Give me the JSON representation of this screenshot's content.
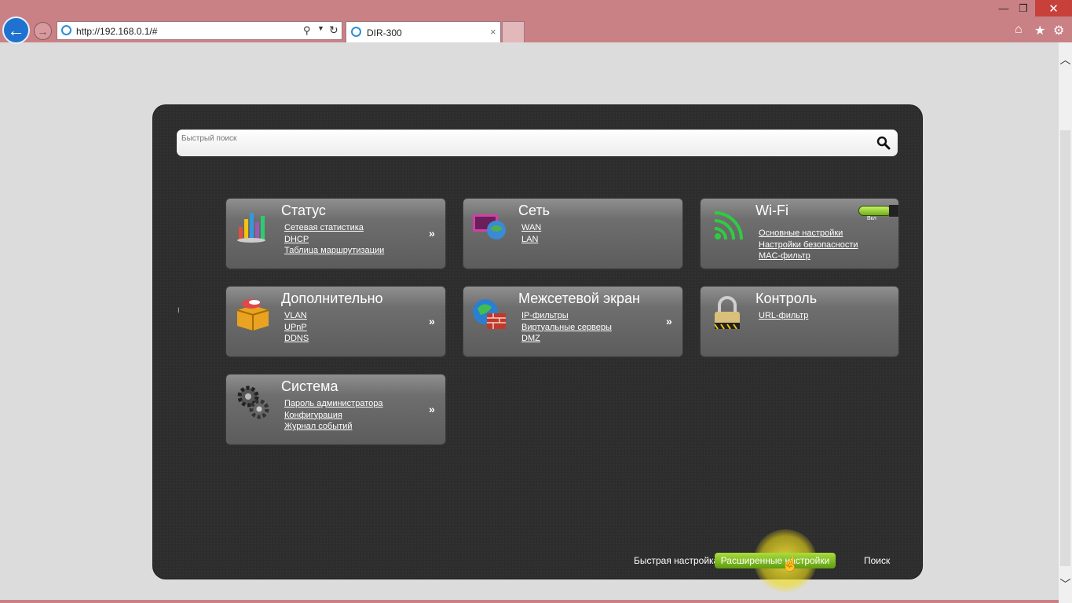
{
  "browser": {
    "address": "http://192.168.0.1/#",
    "tab_title": "DIR-300",
    "tab_close": "×",
    "window_controls": {
      "minimize": "—",
      "restore": "❐",
      "close": "✕"
    },
    "toolbar_icons": [
      "home-icon",
      "favorites-icon",
      "settings-icon"
    ]
  },
  "search": {
    "placeholder": "Быстрый поиск"
  },
  "tiles": [
    {
      "title": "Статус",
      "icon": "chart-icon",
      "links": [
        "Сетевая статистика",
        "DHCP",
        "Таблица маршрутизации"
      ],
      "more": "»"
    },
    {
      "title": "Сеть",
      "icon": "network-icon",
      "links": [
        "WAN",
        "LAN"
      ],
      "more": ""
    },
    {
      "title": "Wi-Fi",
      "icon": "wifi-icon",
      "links": [
        "Основные настройки",
        "Настройки безопасности",
        "MAC-фильтр"
      ],
      "more": "",
      "toggle_label": "Вкл",
      "toggle_on": true
    },
    {
      "title": "Дополнительно",
      "icon": "box-icon",
      "links": [
        "VLAN",
        "UPnP",
        "DDNS"
      ],
      "more": "»"
    },
    {
      "title": "Межсетевой экран",
      "icon": "firewall-icon",
      "links": [
        "IP-фильтры",
        "Виртуальные серверы",
        "DMZ"
      ],
      "more": "»"
    },
    {
      "title": "Контроль",
      "icon": "lock-icon",
      "links": [
        "URL-фильтр"
      ],
      "more": ""
    },
    {
      "title": "Система",
      "icon": "gears-icon",
      "links": [
        "Пароль администратора",
        "Конфигурация",
        "Журнал событий"
      ],
      "more": "»"
    }
  ],
  "bottom_menu": {
    "quick": "Быстрая настройка",
    "advanced": "Расширенные настройки",
    "search": "Поиск"
  },
  "colors": {
    "chrome": "#c98186",
    "panel": "#2d2d2d",
    "accent_green": "#7fc21c"
  }
}
